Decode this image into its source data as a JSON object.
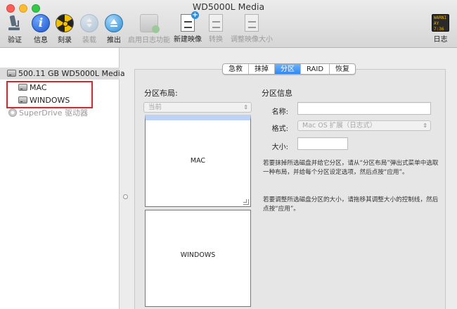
{
  "window": {
    "title": "WD5000L Media"
  },
  "toolbar": {
    "items": [
      {
        "label": "验证",
        "icon": "microscope-icon",
        "enabled": true
      },
      {
        "label": "信息",
        "icon": "info-icon",
        "enabled": true
      },
      {
        "label": "刻录",
        "icon": "burn-icon",
        "enabled": true
      },
      {
        "label": "装载",
        "icon": "mount-icon",
        "enabled": false
      },
      {
        "label": "推出",
        "icon": "eject-icon",
        "enabled": true
      },
      {
        "label": "启用日志功能",
        "icon": "journal-disk-icon",
        "enabled": false
      },
      {
        "label": "新建映像",
        "icon": "new-image-icon",
        "enabled": true
      },
      {
        "label": "转换",
        "icon": "convert-icon",
        "enabled": false
      },
      {
        "label": "调整映像大小",
        "icon": "resize-image-icon",
        "enabled": false
      }
    ],
    "log": {
      "label": "日志",
      "icon": "log-icon",
      "screen_text": "WARNI\nAY 7:36"
    }
  },
  "sidebar": {
    "disk": "500.11 GB WD5000L Media",
    "volumes": [
      "MAC",
      "WINDOWS"
    ],
    "superdrive": "SuperDrive 驱动器"
  },
  "tabs": [
    {
      "label": "急救",
      "active": false
    },
    {
      "label": "抹掉",
      "active": false
    },
    {
      "label": "分区",
      "active": true
    },
    {
      "label": "RAID",
      "active": false
    },
    {
      "label": "恢复",
      "active": false
    }
  ],
  "partition_layout": {
    "title": "分区布局:",
    "scheme_value": "当前",
    "partitions": [
      "MAC",
      "WINDOWS"
    ]
  },
  "partition_info": {
    "title": "分区信息",
    "name_label": "名称:",
    "name_value": "",
    "format_label": "格式:",
    "format_value": "Mac OS 扩展（日志式）",
    "size_label": "大小:",
    "size_value": "",
    "help1": "若要抹掉所选磁盘并给它分区，请从“分区布局”弹出式菜单中选取一种布局，并给每个分区设定选项，然后点按“应用”。",
    "help2": "若要调整所选磁盘分区的大小，请拖移其调整大小的控制线，然后点按“应用”。"
  }
}
